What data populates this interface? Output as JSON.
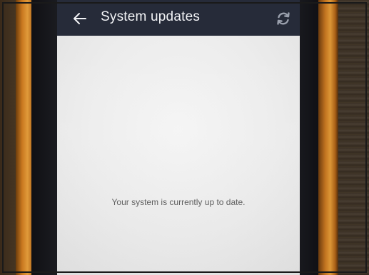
{
  "screen": {
    "app_bar": {
      "title": "System updates",
      "back_icon": "arrow-back-icon",
      "refresh_icon": "refresh-icon",
      "background_color": "#262b39"
    },
    "content": {
      "status_message": "Your system is currently up to date."
    }
  }
}
